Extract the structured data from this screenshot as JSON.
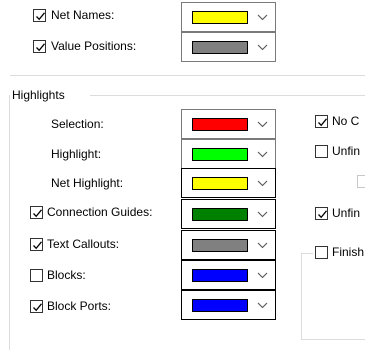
{
  "top_section": {
    "items": [
      {
        "label": "Net Names:",
        "checked": true,
        "color": "#ffff00"
      },
      {
        "label": "Value Positions:",
        "checked": true,
        "color": "#808080"
      }
    ]
  },
  "highlights": {
    "title": "Highlights",
    "items": [
      {
        "label": "Selection:",
        "has_checkbox": false,
        "color": "#ff0000"
      },
      {
        "label": "Highlight:",
        "has_checkbox": false,
        "color": "#00ff00"
      },
      {
        "label": "Net Highlight:",
        "has_checkbox": false,
        "color": "#ffff00"
      },
      {
        "label": "Connection Guides:",
        "has_checkbox": true,
        "checked": true,
        "color": "#008000"
      },
      {
        "label": "Text Callouts:",
        "has_checkbox": true,
        "checked": true,
        "color": "#808080"
      },
      {
        "label": "Blocks:",
        "has_checkbox": true,
        "checked": false,
        "color": "#0000ff"
      },
      {
        "label": "Block Ports:",
        "has_checkbox": true,
        "checked": true,
        "color": "#0000ff"
      }
    ]
  },
  "right_column": {
    "items": [
      {
        "label": "No C",
        "checked": true
      },
      {
        "label": "Unfin",
        "checked": false
      },
      {
        "label": "",
        "checked": false,
        "disabled": true
      },
      {
        "label": "Unfin",
        "checked": true
      },
      {
        "label": "Finish",
        "checked": false
      }
    ]
  }
}
